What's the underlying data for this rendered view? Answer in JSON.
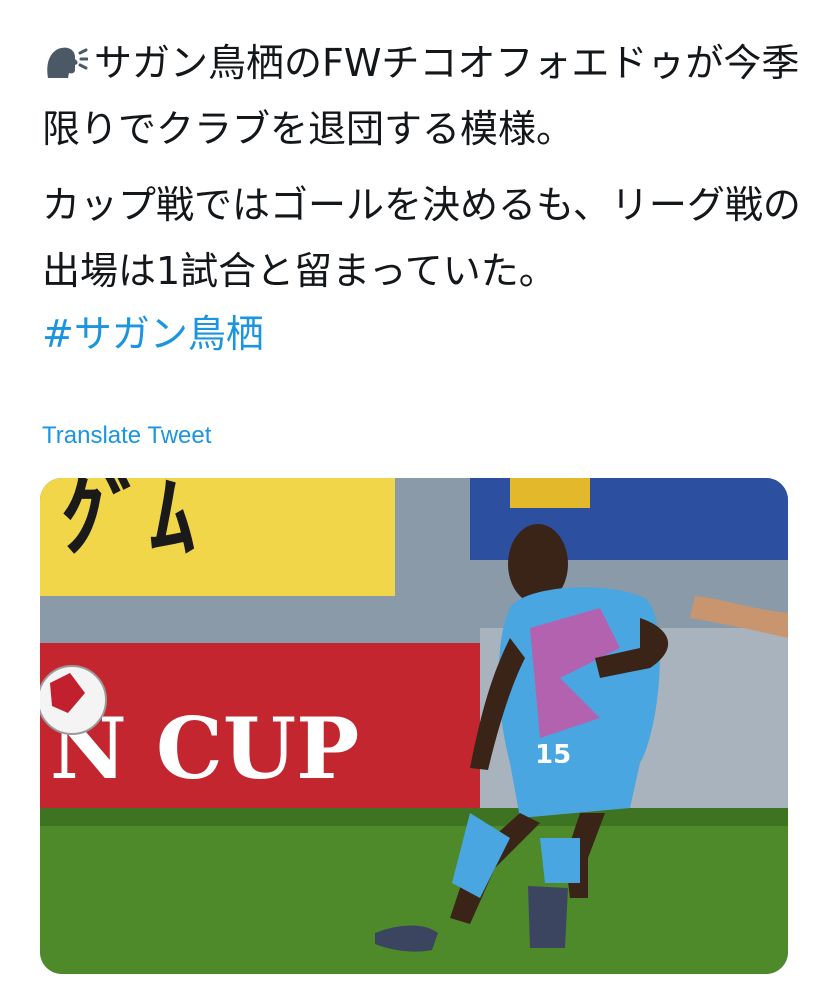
{
  "tweet": {
    "line1_icon": "speaking-head-icon",
    "paragraph1": "サガン鳥栖のFWチコオフォエドゥが今季限りでクラブを退団する模様。",
    "paragraph2": "カップ戦ではゴールを決めるも、リーグ戦の出場は1試合と留まっていた。",
    "hashtag": "#サガン鳥栖",
    "translate_label": "Translate Tweet"
  },
  "media": {
    "banner_text_left": "ｸﾞﾑ",
    "banner_text_cup": "N CUP",
    "jersey_number": "15",
    "colors": {
      "link": "#1b95e0",
      "jersey": "#4aa6e0",
      "pitch": "#4e8a2a"
    }
  }
}
